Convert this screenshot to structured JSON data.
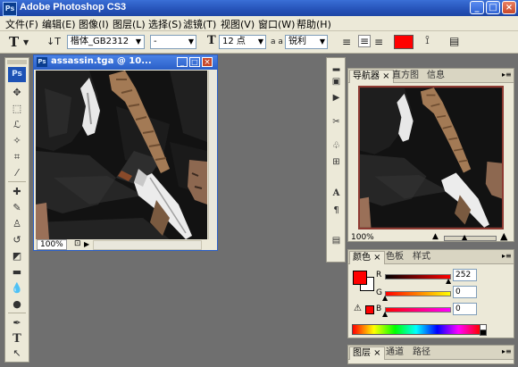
{
  "app": {
    "title": "Adobe Photoshop CS3",
    "logo": "Ps"
  },
  "window_buttons": {
    "minimize": "_",
    "maximize": "□",
    "close": "×"
  },
  "menu": [
    "文件(F)",
    "编辑(E)",
    "图像(I)",
    "图层(L)",
    "选择(S)",
    "滤镜(T)",
    "视图(V)",
    "窗口(W)",
    "帮助(H)"
  ],
  "options": {
    "tool_icon": "T",
    "font_family": "楷体_GB2312",
    "font_style": "-",
    "font_size": "12 点",
    "antialias_prefix": "a a",
    "antialias": "锐利",
    "color": "#ff0000"
  },
  "document": {
    "title": "assassin.tga @ 10...",
    "zoom": "100%"
  },
  "navigator": {
    "tabs": [
      "导航器 ×",
      "直方图",
      "信息"
    ],
    "zoom": "100%"
  },
  "color_panel": {
    "tabs": [
      "颜色 ×",
      "色板",
      "样式"
    ],
    "channels": [
      {
        "label": "R",
        "value": "252"
      },
      {
        "label": "G",
        "value": "0"
      },
      {
        "label": "B",
        "value": "0"
      }
    ],
    "foreground": "#ff0000",
    "warning_swatch": "#ff0000"
  },
  "layers_panel": {
    "tabs": [
      "图层 ×",
      "通道",
      "路径"
    ]
  }
}
